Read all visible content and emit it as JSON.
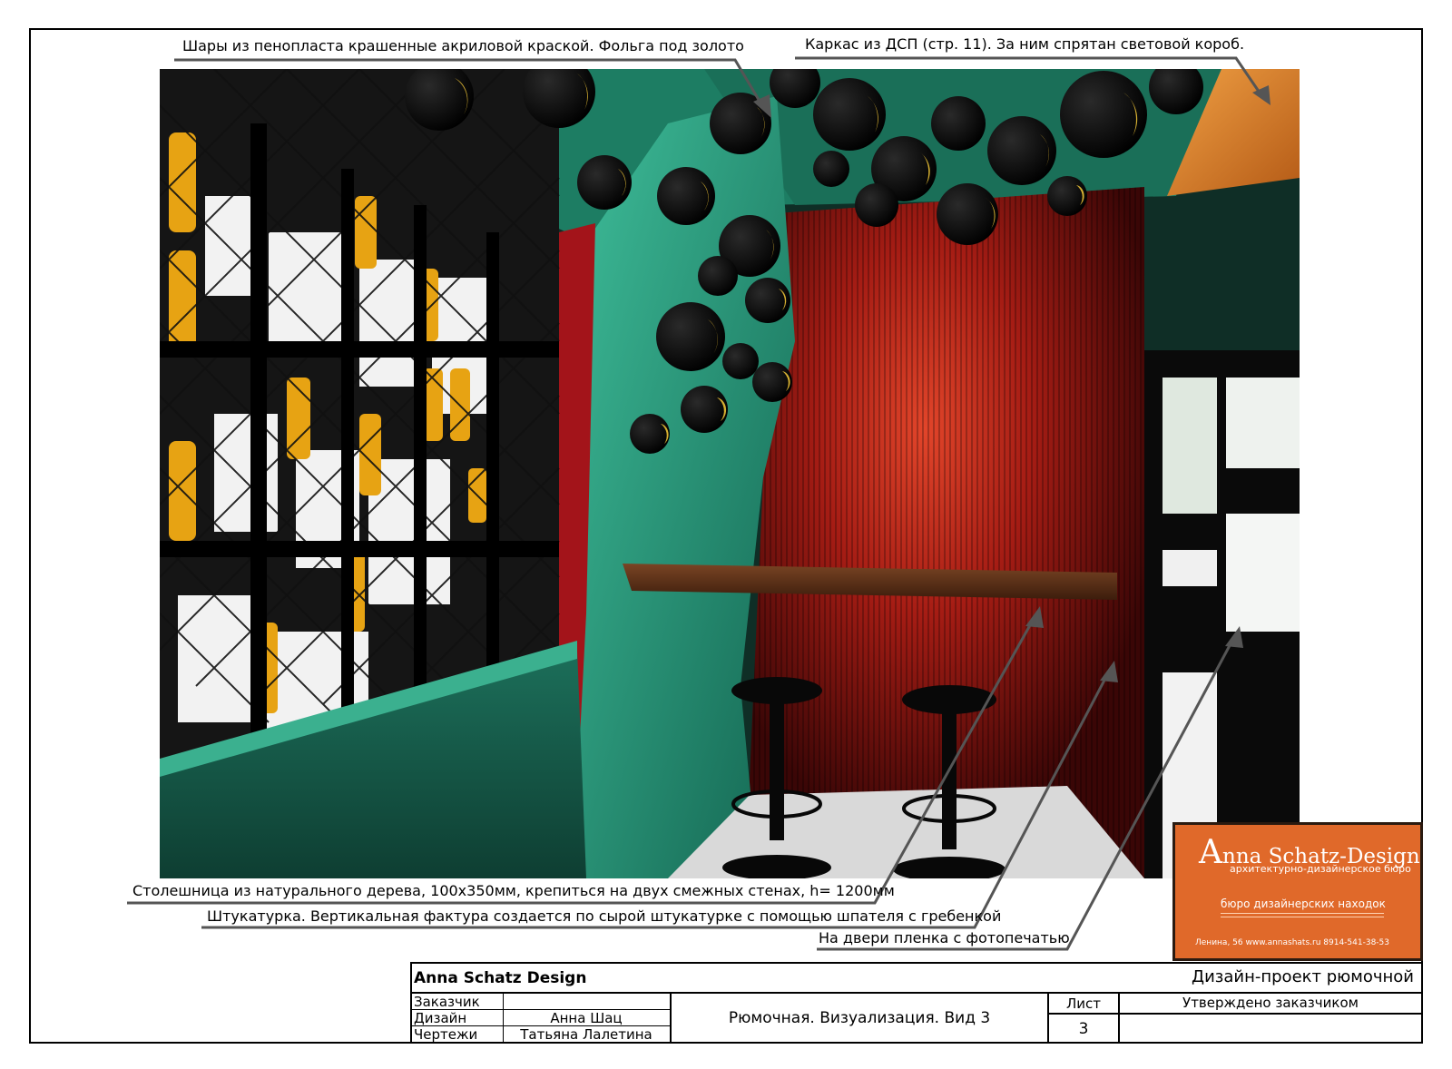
{
  "annotations": {
    "spheres": "Шары из пенопласта крашенные акриловой краской. Фольга под золото",
    "frame": "Каркас из ДСП (стр. 11). За ним спрятан световой короб.",
    "countertop": "Столешница из натурального дерева, 100х350мм, крепиться на двух смежных стенах, h= 1200мм",
    "plaster": "Штукатурка. Вертикальная фактура создается по сырой штукатурке с помощью шпателя с гребенкой",
    "door_film": "На двери пленка с фотопечатью"
  },
  "stamp": {
    "brand_initial": "A",
    "brand_rest": "nna Schatz-Design",
    "subtitle": "архитектурно-дизайнерское бюро",
    "tagline": "бюро дизайнерских находок",
    "contacts": "Ленина, 56     www.annashats.ru    8914-541-38-53"
  },
  "title_block": {
    "studio": "Anna Schatz Design",
    "project": "Дизайн-проект рюмочной",
    "rows": [
      {
        "role": "Заказчик",
        "name": ""
      },
      {
        "role": "Дизайн",
        "name": "Анна Шац"
      },
      {
        "role": "Чертежи",
        "name": "Татьяна Лалетина"
      }
    ],
    "sheet_title": "Рюмочная. Визуализация. Вид 3",
    "sheet_label": "Лист",
    "sheet_number": "3",
    "approval": "Утверждено заказчиком"
  },
  "colors": {
    "wall_red": "#9c1a14",
    "wall_green": "#1f8a6e",
    "gold": "#d6b032",
    "wood": "#5a3016",
    "stamp_orange": "#e0692a"
  }
}
